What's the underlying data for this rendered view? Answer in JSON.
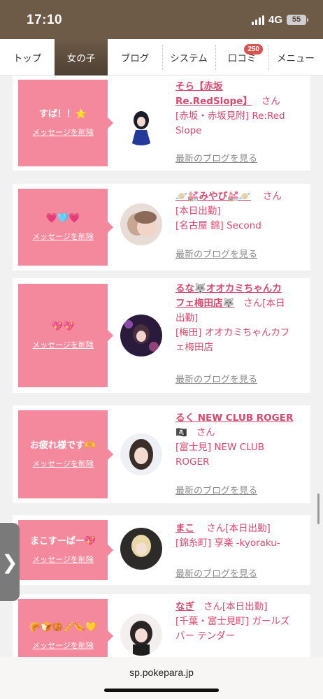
{
  "status": {
    "time": "17:10",
    "network": "4G",
    "battery": "55"
  },
  "nav": {
    "items": [
      {
        "label": "トップ"
      },
      {
        "label": "女の子"
      },
      {
        "label": "ブログ"
      },
      {
        "label": "システム"
      },
      {
        "label": "口コミ",
        "badge": "250"
      },
      {
        "label": "メニュー"
      }
    ]
  },
  "delete_label": "メッセージを削除",
  "blog_label": "最新のブログを見る",
  "san_label": "さん",
  "entries": [
    {
      "message": "すば！！⭐",
      "name_line1": "そら【赤坂",
      "name_line2": "Re.RedSlope】",
      "detail_line1": "[赤坂・赤坂見附] Re:Red",
      "detail_line2": "Slope"
    },
    {
      "message": "💗🩵💗",
      "name": "🪐💒みやび💒🪐",
      "detail_line1": "[本日出勤]",
      "detail_line2": "[名古屋 錦] Second"
    },
    {
      "message": "💖💖",
      "name_line1": "るな🐺オオカミちゃんカ",
      "name_line2": "フェ梅田店🐺",
      "inline_status": "[本日",
      "status_cont": "出勤]",
      "detail_line1": "[梅田] オオカミちゃんカフ",
      "detail_line2": "ェ梅田店"
    },
    {
      "message": "お疲れ様です🫶",
      "name": "るく NEW CLUB ROGER",
      "flag": "🏴‍☠️",
      "detail_line1": "[富士見] NEW CLUB",
      "detail_line2": "ROGER"
    },
    {
      "message": "まこすーぱー💖",
      "name": "まこ",
      "inline_status": "[本日出勤]",
      "detail_line1": "[錦糸町] 享楽 -kyoraku-"
    },
    {
      "message": "🥐🍞🥨🥖🌭💛",
      "name": "なぎ",
      "inline_status": "[本日出勤]",
      "detail_line1": "[千葉・富士見町] ガールズ",
      "detail_line2": "バー テンダー"
    }
  ],
  "colors": {
    "accent": "#d94a6e",
    "bubble": "#f4899d",
    "nav_active": "#5a4a3c"
  },
  "url": "sp.pokepara.jp"
}
